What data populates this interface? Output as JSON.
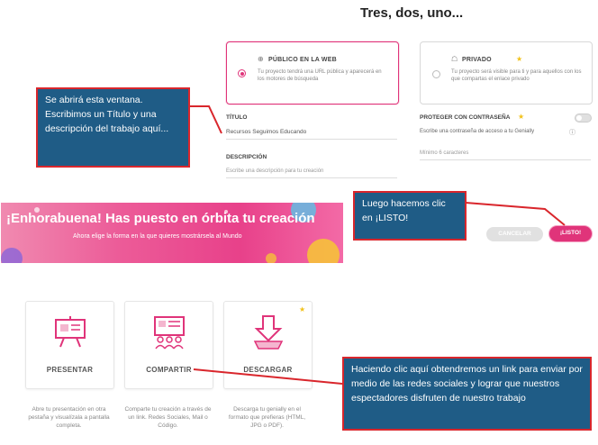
{
  "modal": {
    "title": "Tres, dos, uno...",
    "public": {
      "title": "PÚBLICO EN LA WEB",
      "desc": "Tu proyecto tendrá una URL pública y aparecerá en los motores de búsqueda"
    },
    "private": {
      "title": "PRIVADO",
      "desc": "Tu proyecto será visible para ti y para aquellos con los que compartas el enlace privado"
    },
    "title_label": "TÍTULO",
    "title_value": "Recursos Seguimos Educando",
    "description_label": "DESCRIPCIÓN",
    "description_placeholder": "Escribe una descripción para tu creación",
    "password_label": "PROTEGER CON CONTRASEÑA",
    "password_hint": "Escribe una contraseña de acceso a tu Genially",
    "password_placeholder": "Mínimo 6 caracteres",
    "cancel_label": "CANCELAR",
    "ok_label": "¡LISTO!",
    "accent": "#e0347a"
  },
  "banner": {
    "headline": "¡Enhorabuena! Has puesto en órbita tu creación",
    "subtitle": "Ahora elige la forma en la que quieres mostrársela al Mundo"
  },
  "options": [
    {
      "label": "PRESENTAR",
      "desc": "Abre tu presentación en otra pestaña y visualízala a pantalla completa."
    },
    {
      "label": "COMPARTIR",
      "desc": "Comparte tu creación a través de un link. Redes Sociales, Mail o Código."
    },
    {
      "label": "DESCARGAR",
      "desc": "Descarga tu genially en el formato que prefieras (HTML, JPG o PDF)."
    }
  ],
  "callouts": {
    "window": "Se abrirá esta ventana. Escribimos un Título y una descripción del trabajo aquí...",
    "listo": "Luego hacemos clic en ¡LISTO!",
    "share": "Haciendo clic aquí obtendremos un link para enviar por medio de las redes sociales y lograr que nuestros espectadores disfruten de nuestro trabajo"
  }
}
